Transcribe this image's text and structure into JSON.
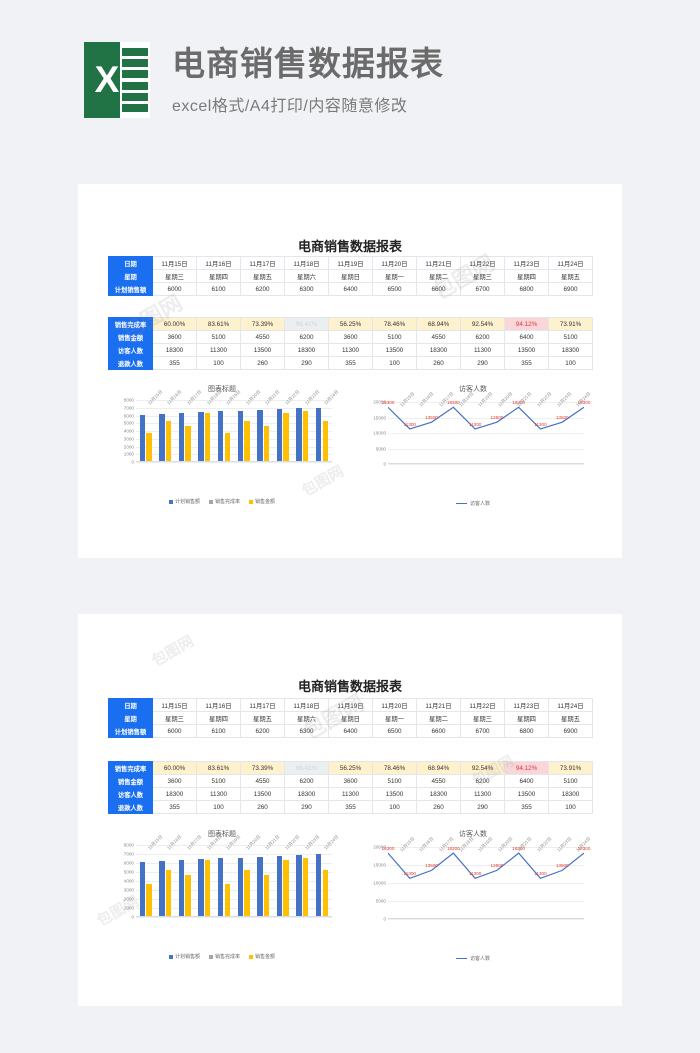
{
  "banner": {
    "logo_letter": "X",
    "title": "电商销售数据报表",
    "subtitle": "excel格式/A4打印/内容随意修改"
  },
  "sheet": {
    "title": "电商销售数据报表",
    "row_labels": {
      "date": "日期",
      "weekday": "星期",
      "plan_sales": "计划销售额",
      "completion_rate": "销售完成率",
      "sales_amount": "销售金额",
      "visitors": "访客人数",
      "refunds": "退款人数"
    },
    "dates": [
      "11月15日",
      "11月16日",
      "11月17日",
      "11月18日",
      "11月19日",
      "11月20日",
      "11月21日",
      "11月22日",
      "11月23日",
      "11月24日"
    ],
    "weekdays": [
      "星期三",
      "星期四",
      "星期五",
      "星期六",
      "星期日",
      "星期一",
      "星期二",
      "星期三",
      "星期四",
      "星期五"
    ],
    "plan_sales": [
      6000,
      6100,
      6200,
      6300,
      6400,
      6500,
      6600,
      6700,
      6800,
      6900
    ],
    "completion_rate": [
      "60.00%",
      "83.61%",
      "73.39%",
      "98.41%",
      "56.25%",
      "78.46%",
      "68.94%",
      "92.54%",
      "94.12%",
      "73.91%"
    ],
    "completion_rate_styles": [
      "yellow",
      "yellow",
      "yellow",
      "gray",
      "yellow",
      "yellow",
      "yellow",
      "yellow",
      "pink",
      "yellow"
    ],
    "sales_amount": [
      3600,
      5100,
      4550,
      6200,
      3600,
      5100,
      4550,
      6200,
      6400,
      5100
    ],
    "visitors": [
      18300,
      11300,
      13500,
      18300,
      11300,
      13500,
      18300,
      11300,
      13500,
      18300
    ],
    "refunds": [
      355,
      100,
      260,
      290,
      355,
      100,
      260,
      290,
      355,
      100
    ]
  },
  "colors": {
    "header_blue": "#1a6ef0",
    "bar_plan": "#4472c4",
    "bar_sales": "#ffc000",
    "line": "#4472c4",
    "label_red": "#e8392f",
    "pct_yellow_bg": "#fdf2cd",
    "pct_pink_bg": "#fbd6d8",
    "logo_green": "#217346"
  },
  "chart_data": [
    {
      "type": "bar",
      "title": "图表标题",
      "categories": [
        "11月15日",
        "11月16日",
        "11月17日",
        "11月18日",
        "11月19日",
        "11月20日",
        "11月21日",
        "11月22日",
        "11月23日",
        "11月24日"
      ],
      "series": [
        {
          "name": "计划销售额",
          "values": [
            6000,
            6100,
            6200,
            6300,
            6400,
            6500,
            6600,
            6700,
            6800,
            6900
          ],
          "color": "#4472c4"
        },
        {
          "name": "销售完成率",
          "values": [
            0.6,
            0.8361,
            0.7339,
            0.9841,
            0.5625,
            0.7846,
            0.6894,
            0.9254,
            0.9412,
            0.7391
          ],
          "color": "#a5a5a5"
        },
        {
          "name": "销售金额",
          "values": [
            3600,
            5100,
            4550,
            6200,
            3600,
            5100,
            4550,
            6200,
            6400,
            5100
          ],
          "color": "#ffc000"
        }
      ],
      "yticks": [
        0,
        1000,
        2000,
        3000,
        4000,
        5000,
        6000,
        7000,
        8000
      ],
      "ylim": [
        0,
        8000
      ],
      "xlabel": "",
      "ylabel": "",
      "grid": true,
      "legend_position": "bottom"
    },
    {
      "type": "line",
      "title": "访客人数",
      "categories": [
        "11月15日",
        "11月16日",
        "11月17日",
        "11月18日",
        "11月19日",
        "11月20日",
        "11月21日",
        "11月22日",
        "11月23日",
        "11月24日"
      ],
      "series": [
        {
          "name": "访客人数",
          "values": [
            18300,
            11300,
            13500,
            18300,
            11300,
            13500,
            18300,
            11300,
            13500,
            18300
          ],
          "color": "#4472c4"
        }
      ],
      "data_labels": [
        "18300",
        "11300",
        "13500",
        "18300",
        "11300",
        "13500",
        "18300",
        "11300",
        "13500",
        "18300"
      ],
      "yticks": [
        0,
        5000,
        10000,
        15000,
        20000
      ],
      "ylim": [
        0,
        20000
      ],
      "xlabel": "",
      "ylabel": "",
      "grid": true,
      "legend_position": "bottom"
    }
  ],
  "watermark": {
    "text": "包图网"
  }
}
